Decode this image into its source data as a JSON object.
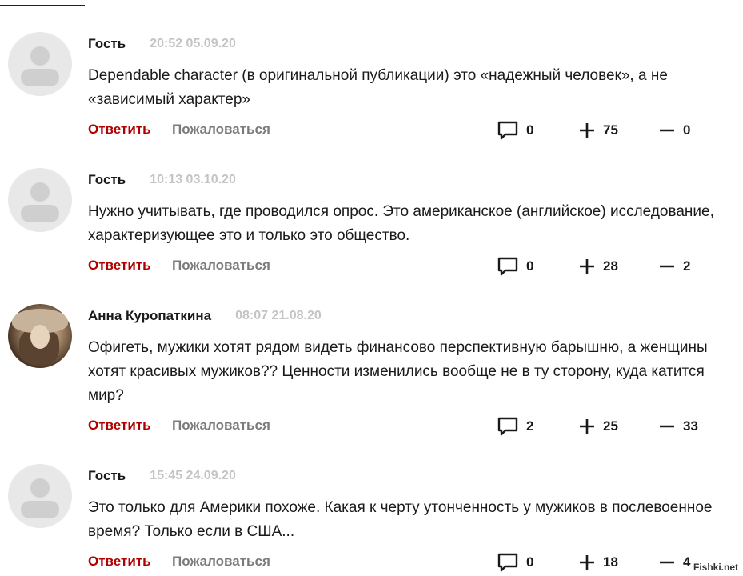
{
  "comments": [
    {
      "author": "Гость",
      "time": "20:52 05.09.20",
      "text": "Dependable character (в оригинальной публикации) это «надежный человек», а не «зависимый характер»",
      "reply_label": "Ответить",
      "report_label": "Пожаловаться",
      "replies": "0",
      "likes": "75",
      "dislikes": "0"
    },
    {
      "author": "Гость",
      "time": "10:13 03.10.20",
      "text": "Нужно учитывать, где проводился опрос. Это американское (английское) исследование, характеризующее это и только это общество.",
      "reply_label": "Ответить",
      "report_label": "Пожаловаться",
      "replies": "0",
      "likes": "28",
      "dislikes": "2"
    },
    {
      "author": "Анна Куропаткина",
      "time": "08:07 21.08.20",
      "text": "Офигеть, мужики хотят рядом видеть финансово перспективную барышню, а женщины хотят красивых мужиков?? Ценности изменились вообще не в ту сторону, куда катится мир?",
      "reply_label": "Ответить",
      "report_label": "Пожаловаться",
      "replies": "2",
      "likes": "25",
      "dislikes": "33"
    },
    {
      "author": "Гость",
      "time": "15:45 24.09.20",
      "text": "Это только для Америки похоже. Какая к черту утонченность у мужиков в послевоенное время? Только если в США...",
      "reply_label": "Ответить",
      "report_label": "Пожаловаться",
      "replies": "0",
      "likes": "18",
      "dislikes": "4"
    }
  ],
  "watermark": "Fishki.net",
  "colors": {
    "reply": "#b00000",
    "report": "#7a7a7a",
    "timestamp": "#c4c4c4",
    "avatar_bg": "#e8e8e8"
  }
}
